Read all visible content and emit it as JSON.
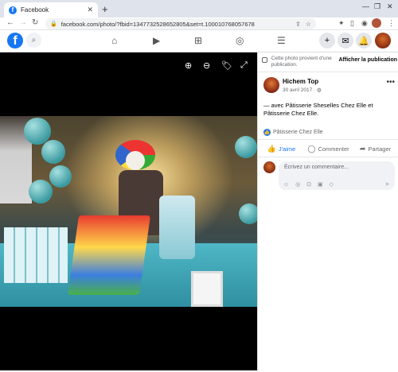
{
  "browser": {
    "tab_title": "Facebook",
    "tab_close": "✕",
    "new_tab": "+",
    "url": "facebook.com/photo/?fbid=1347732528652805&set=t.100010768057678",
    "window_controls": [
      "—",
      "❐",
      "✕"
    ]
  },
  "facebook": {
    "logo": "f",
    "nav_icons": [
      "home-icon",
      "watch-icon",
      "marketplace-icon",
      "groups-icon",
      "menu-icon"
    ],
    "right_buttons": [
      "+",
      "m",
      "🔔"
    ]
  },
  "viewer": {
    "tools": [
      "⊕",
      "⊖",
      "🏷",
      "⤢"
    ]
  },
  "post": {
    "notice_text": "Cette photo provient d'une publication.",
    "notice_link": "Afficher la publication",
    "author": "Hichem Top",
    "date": "30 avril 2017 · ",
    "more": "•••",
    "text": "— avec Pâtisserie Sheselles Chez Elle et Pâtisserie Chez Elle.",
    "reaction_name": "Pâtisserie Chez Elle",
    "actions": {
      "like": "J'aime",
      "comment": "Commenter",
      "share": "Partager"
    },
    "comment_placeholder": "Écrivez un commentaire...",
    "comment_tools": "☺ ◎ ⊡ ▣ ◇"
  },
  "colors": {
    "facebook_blue": "#1877f2",
    "secondary_text": "#65676b"
  }
}
